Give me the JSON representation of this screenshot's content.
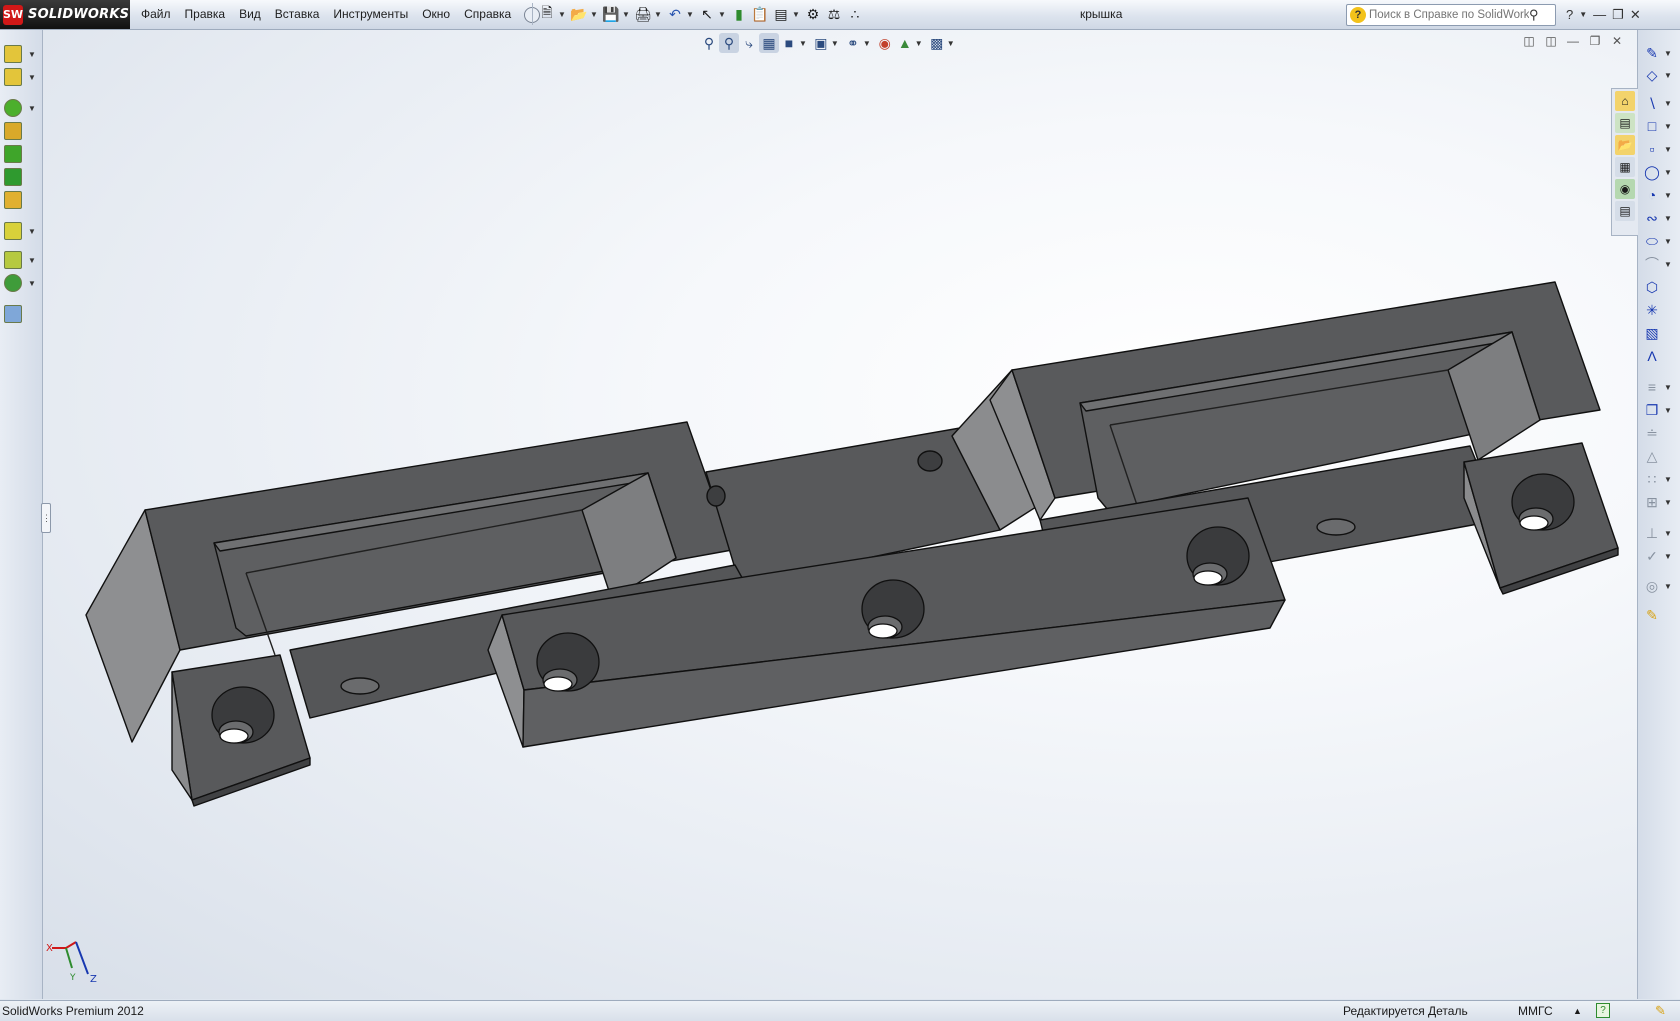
{
  "app": {
    "brand": "SOLIDWORKS",
    "brand_badge": "SW",
    "document_title": "крышка"
  },
  "menu": [
    "Файл",
    "Правка",
    "Вид",
    "Вставка",
    "Инструменты",
    "Окно",
    "Справка"
  ],
  "search": {
    "placeholder": "Поиск в Справке по SolidWorks"
  },
  "help_label": "?",
  "triad": {
    "x": "X",
    "y": "Y",
    "z": "Z"
  },
  "statusbar": {
    "left": "SolidWorks Premium 2012",
    "mode": "Редактируется Деталь",
    "units": "ММГС",
    "units_arrow": "▲"
  },
  "colors": {
    "model_face": "#5b5c5e",
    "model_side": "#898a8c",
    "model_edge": "#101010",
    "accent": "#d01818"
  }
}
